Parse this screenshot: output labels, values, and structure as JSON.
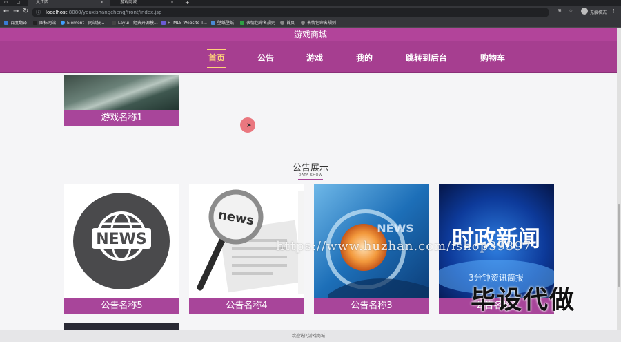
{
  "browser": {
    "tabs": [
      {
        "label": "大江西"
      },
      {
        "label": "游戏商城"
      }
    ],
    "url_host": "localhost",
    "url_path": ":8080/youxishangcheng/front/index.jsp",
    "guest_label": "无痕模式",
    "bookmarks": [
      {
        "label": "百度翻译"
      },
      {
        "label": "图标网站"
      },
      {
        "label": "Element - 网站快..."
      },
      {
        "label": "Layui - 经典开源模..."
      },
      {
        "label": "HTML5 Website T..."
      },
      {
        "label": "壁纸壁纸"
      },
      {
        "label": "表情包命名规则"
      },
      {
        "label": "首页"
      },
      {
        "label": "表情包命名规则"
      }
    ]
  },
  "site": {
    "title": "游戏商城",
    "nav": [
      {
        "label": "首页"
      },
      {
        "label": "公告"
      },
      {
        "label": "游戏"
      },
      {
        "label": "我的"
      },
      {
        "label": "跳转到后台"
      },
      {
        "label": "购物车"
      }
    ]
  },
  "games": [
    {
      "caption": "游戏名称1"
    }
  ],
  "notice_section": {
    "title": "公告展示",
    "subtitle": "DATA SHOW"
  },
  "notices": [
    {
      "caption": "公告名称5",
      "badge": "NEWS"
    },
    {
      "caption": "公告名称4",
      "badge": "news"
    },
    {
      "caption": "公告名称3",
      "badge": "NEWS"
    },
    {
      "caption": "公告名称2",
      "badge": "时政新闻",
      "subtext": "3分钟资讯简报"
    }
  ],
  "footer": {
    "text": "欢迎访问游戏商城！"
  },
  "watermark": {
    "text": "https://www.huzhan.com/ishop39397",
    "text2": "毕设代做"
  }
}
